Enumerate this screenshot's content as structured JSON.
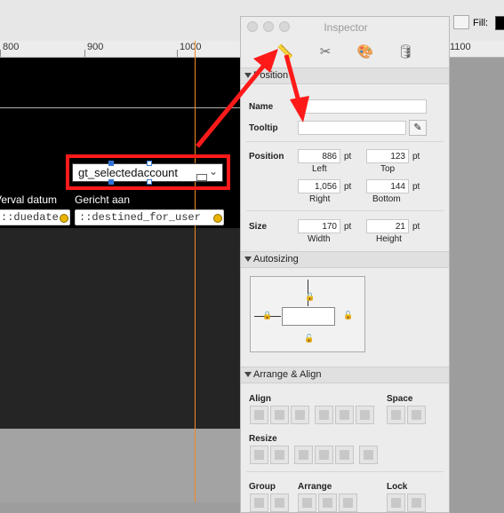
{
  "toolbar": {
    "fill_label": "Fill:"
  },
  "ruler": {
    "labels": [
      "800",
      "900",
      "1000",
      "1100"
    ]
  },
  "layout": {
    "col1_label": "Verval datum",
    "col2_label": "Gericht aan",
    "field1_value": "::duedate",
    "field2_value": "::destined_for_user",
    "selected_field_value": "gt_selectedaccount"
  },
  "inspector": {
    "title": "Inspector",
    "tabs": [
      {
        "name": "position",
        "icon": "ruler-icon"
      },
      {
        "name": "tools",
        "icon": "tools-icon"
      },
      {
        "name": "appearance",
        "icon": "palette-icon"
      },
      {
        "name": "data",
        "icon": "database-icon"
      }
    ],
    "position_section": {
      "title": "Position",
      "name_label": "Name",
      "name_value": "",
      "tooltip_label": "Tooltip",
      "tooltip_value": "",
      "position_label": "Position",
      "left": "886",
      "top": "123",
      "right": "1,056",
      "bottom": "144",
      "left_label": "Left",
      "top_label": "Top",
      "right_label": "Right",
      "bottom_label": "Bottom",
      "unit": "pt",
      "size_label": "Size",
      "width": "170",
      "height": "21",
      "width_label": "Width",
      "height_label": "Height"
    },
    "autosizing_section": {
      "title": "Autosizing"
    },
    "arrange_section": {
      "title": "Arrange & Align",
      "align_label": "Align",
      "space_label": "Space",
      "resize_label": "Resize",
      "group_label": "Group",
      "arrange_label": "Arrange",
      "lock_label": "Lock"
    }
  },
  "colors": {
    "annotation": "#ff1a1a",
    "guide": "#f08a24",
    "accent": "#2f6fd8"
  }
}
